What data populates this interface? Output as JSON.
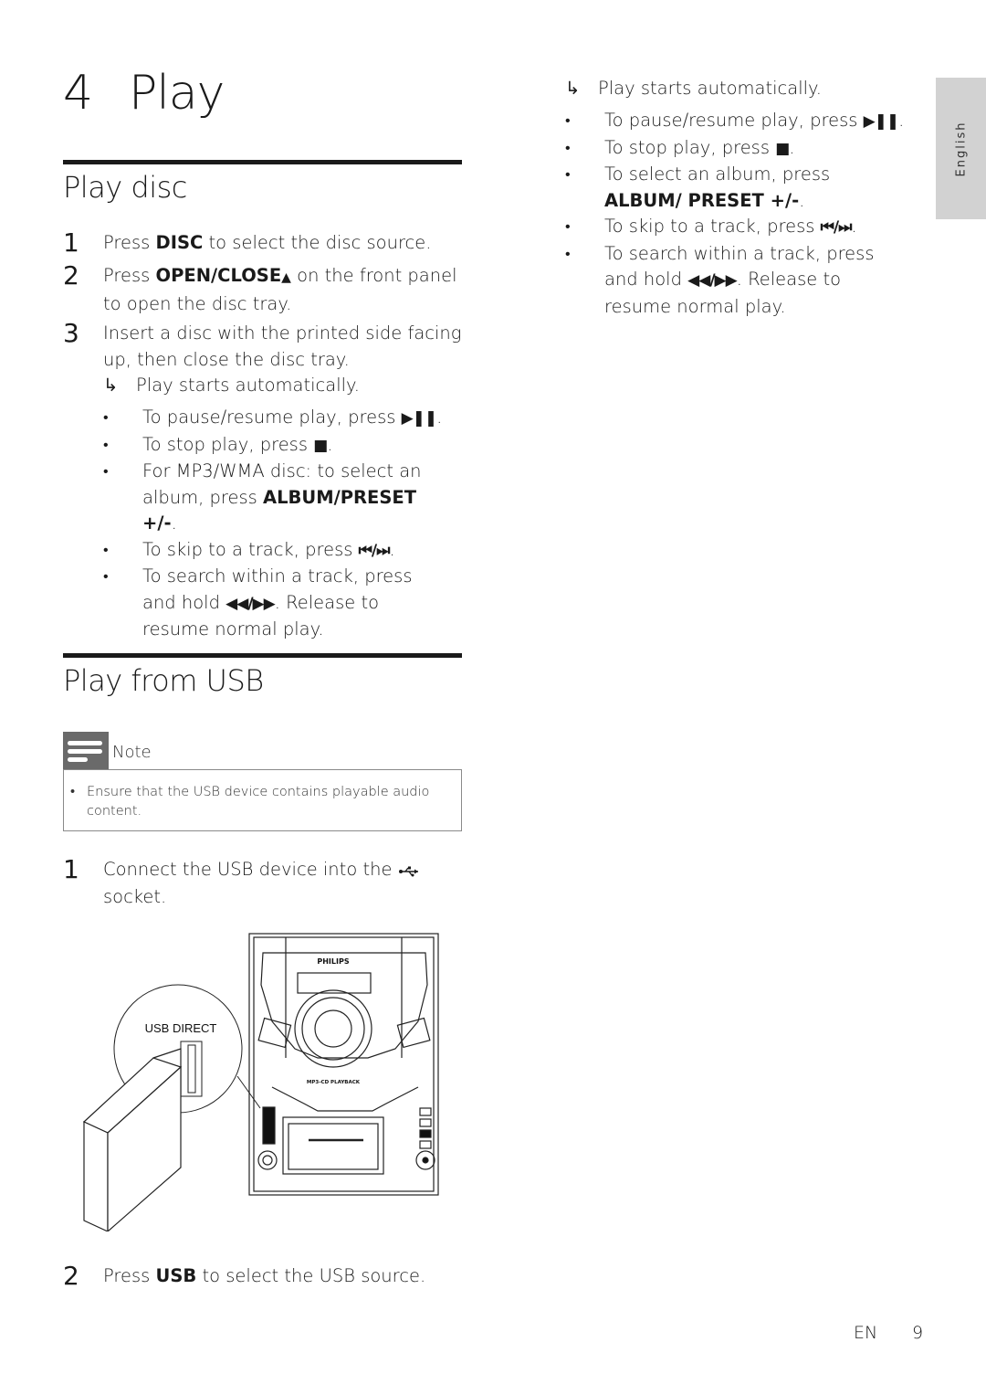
{
  "chapter": {
    "number": "4",
    "title": "Play"
  },
  "sections": {
    "play_disc": {
      "title": "Play disc",
      "steps": [
        {
          "num": "1",
          "pre": "Press ",
          "bold": "DISC",
          "post": " to select the disc source."
        },
        {
          "num": "2",
          "pre": "Press ",
          "bold": "OPEN/CLOSE",
          "symbol": "▲",
          "post": " on the front panel to open the disc tray."
        },
        {
          "num": "3",
          "text": "Insert a disc with the printed side facing up, then close the disc tray."
        }
      ],
      "result": {
        "arrow": "↳",
        "text": "Play starts automatically."
      },
      "bullets": [
        {
          "pre": "To pause/resume play, press ",
          "symbol": "▶❚❚",
          "post": "."
        },
        {
          "pre": "To stop play, press ",
          "symbol": "■",
          "post": "."
        },
        {
          "pre": "For MP3/WMA disc: to select an album, press ",
          "bold": "ALBUM/PRESET +/-",
          "post": "."
        },
        {
          "pre": "To skip to a track, press ",
          "symbol": "⏮/⏭",
          "post": "."
        },
        {
          "pre": "To search within a track, press and hold ",
          "symbol": "◀◀/▶▶",
          "post": ". Release to resume normal play."
        }
      ]
    },
    "play_usb": {
      "title": "Play from USB",
      "note": {
        "label": "Note",
        "items": [
          "Ensure that the USB device contains playable audio content."
        ]
      },
      "steps": [
        {
          "num": "1",
          "text": "Connect the USB device into the",
          "symbol": "⭠",
          "post": "socket."
        },
        {
          "num": "2",
          "pre": "Press ",
          "bold": "USB",
          "post": " to select the USB source."
        }
      ],
      "illustration": {
        "callout_label": "USB DIRECT",
        "brand": "PHILIPS",
        "panel_label": "MP3-CD PLAYBACK"
      }
    }
  },
  "right_column": {
    "result": {
      "arrow": "↳",
      "text": "Play starts automatically."
    },
    "bullets": [
      {
        "pre": "To pause/resume play, press ",
        "symbol": "▶❚❚",
        "post": "."
      },
      {
        "pre": "To stop play, press ",
        "symbol": "■",
        "post": "."
      },
      {
        "pre": "To select an album, press ",
        "bold": "ALBUM/ PRESET +/-",
        "post": "."
      },
      {
        "pre": "To skip to a track, press ",
        "symbol": "⏮/⏭",
        "post": "."
      },
      {
        "pre": "To search within a track, press and hold ",
        "symbol": "◀◀/▶▶",
        "post": ". Release to resume normal play."
      }
    ]
  },
  "language_tab": "English",
  "footer": {
    "lang": "EN",
    "page": "9"
  }
}
